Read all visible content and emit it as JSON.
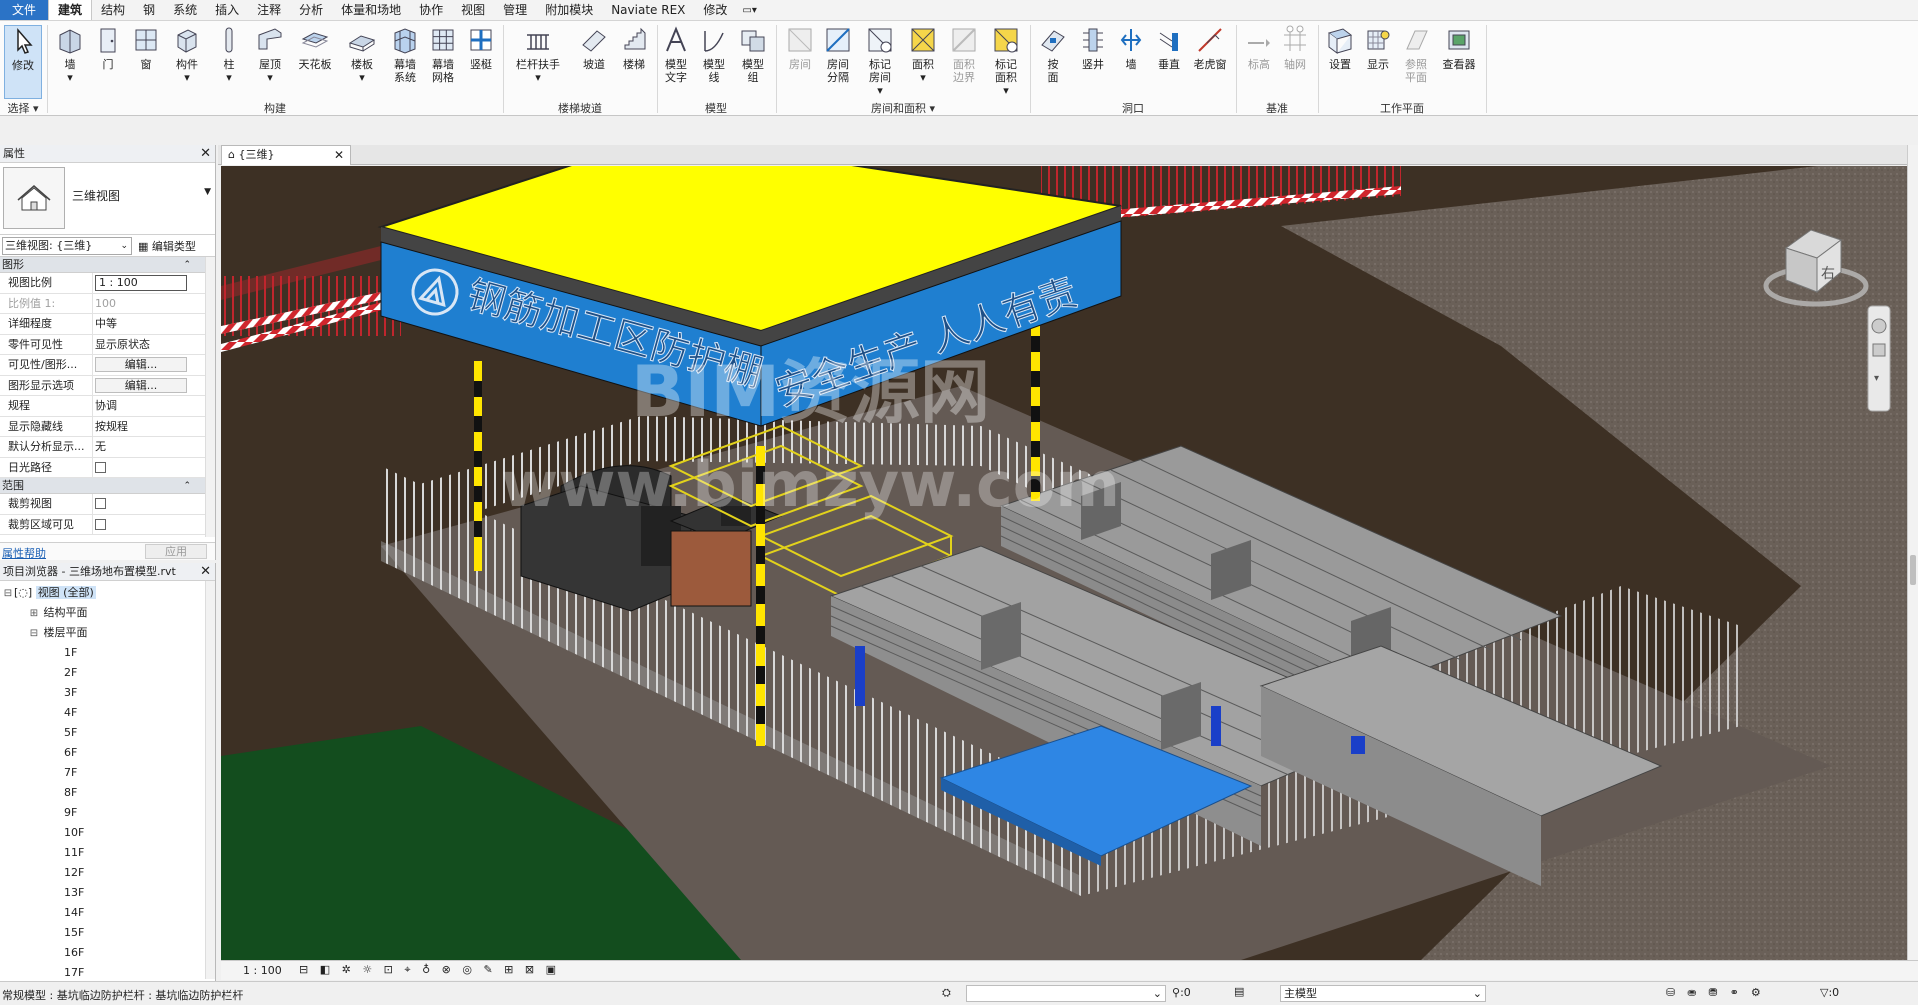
{
  "menu": {
    "tabs": [
      "文件",
      "建筑",
      "结构",
      "钢",
      "系统",
      "插入",
      "注释",
      "分析",
      "体量和场地",
      "协作",
      "视图",
      "管理",
      "附加模块",
      "Naviate REX",
      "修改"
    ],
    "active": "建筑"
  },
  "ribbon": {
    "buttons": {
      "modify": "修改",
      "wall": "墙",
      "door": "门",
      "window": "窗",
      "component": "构件",
      "column": "柱",
      "roof": "屋顶",
      "ceiling": "天花板",
      "floor": "楼板",
      "curtain_system": "幕墙\n系统",
      "curtain_grid": "幕墙\n网格",
      "mullion": "竖梃",
      "railing": "栏杆扶手",
      "ramp": "坡道",
      "stair": "楼梯",
      "model_text": "模型\n文字",
      "model_line": "模型\n线",
      "model_group": "模型\n组",
      "room": "房间",
      "room_separator": "房间\n分隔",
      "tag_room": "标记\n房间",
      "area": "面积",
      "area_boundary": "面积\n边界",
      "tag_area": "标记\n面积",
      "by_face": "按\n面",
      "shaft": "竖井",
      "opening_wall": "墙",
      "vertical": "垂直",
      "dormer": "老虎窗",
      "level": "标高",
      "grid": "轴网",
      "set": "设置",
      "show": "显示",
      "ref_plane": "参照\n平面",
      "viewer": "查看器"
    },
    "groups": {
      "select": "选择",
      "build": "构建",
      "circulation": "楼梯坡道",
      "model": "模型",
      "room_area": "房间和面积",
      "opening": "洞口",
      "datum": "基准",
      "workplane": "工作平面"
    }
  },
  "properties": {
    "title": "属性",
    "type_name": "三维视图",
    "instance_selector": "三维视图: {三维}",
    "edit_type": "编辑类型",
    "category_graphics": "图形",
    "rows": [
      {
        "k": "视图比例",
        "v": "1 : 100"
      },
      {
        "k": "比例值 1:",
        "v": "100"
      },
      {
        "k": "详细程度",
        "v": "中等"
      },
      {
        "k": "零件可见性",
        "v": "显示原状态"
      },
      {
        "k": "可见性/图形...",
        "v": "编辑..."
      },
      {
        "k": "图形显示选项",
        "v": "编辑..."
      },
      {
        "k": "规程",
        "v": "协调"
      },
      {
        "k": "显示隐藏线",
        "v": "按规程"
      },
      {
        "k": "默认分析显示...",
        "v": "无"
      },
      {
        "k": "日光路径",
        "v": ""
      }
    ],
    "category_extents": "范围",
    "extent_rows": [
      {
        "k": "裁剪视图",
        "v": ""
      },
      {
        "k": "裁剪区域可见",
        "v": ""
      }
    ],
    "help": "属性帮助",
    "apply": "应用"
  },
  "browser": {
    "title": "项目浏览器 - 三维场地布置模型.rvt",
    "root": "视图 (全部)",
    "structural": "结构平面",
    "floor_plans": "楼层平面",
    "levels": [
      "1F",
      "2F",
      "3F",
      "4F",
      "5F",
      "6F",
      "7F",
      "8F",
      "9F",
      "10F",
      "11F",
      "12F",
      "13F",
      "14F",
      "15F",
      "16F",
      "17F"
    ]
  },
  "view": {
    "tab": "{三维}",
    "scale": "1 : 100",
    "viewcube": "右"
  },
  "scene": {
    "canopy_left_banner": "钢筋加工区防护棚",
    "canopy_right_banner": "安全生产 人人有责",
    "watermark_1": "BIM资源网",
    "watermark_2": "www.bimzyw.com"
  },
  "status": {
    "message": "常规模型 : 基坑临边防护栏杆 : 基坑临边防护栏杆",
    "sel_count": ":0",
    "workset": "主模型",
    "filter_count": ":0"
  },
  "colors": {
    "accent": "#2b73c6",
    "canopy_roof": "#ffff00",
    "banner_blue": "#1f7fd0",
    "ground": "#4a3e32",
    "grass": "#134d1e"
  }
}
